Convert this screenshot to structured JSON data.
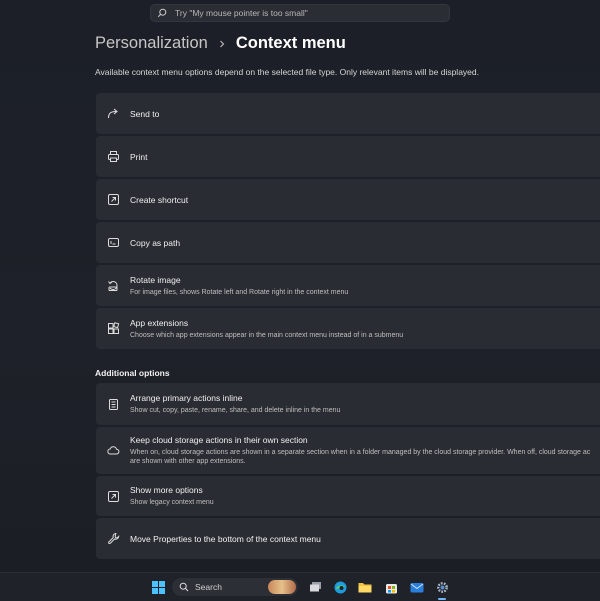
{
  "search": {
    "placeholder": "Try \"My mouse pointer is too small\""
  },
  "breadcrumb": {
    "parent": "Personalization",
    "separator": "›",
    "current": "Context menu"
  },
  "description": "Available context menu options depend on the selected file type. Only relevant items will be displayed.",
  "items": [
    {
      "title": "Send to",
      "subtitle": "",
      "icon": "share-arrow-icon"
    },
    {
      "title": "Print",
      "subtitle": "",
      "icon": "printer-icon"
    },
    {
      "title": "Create shortcut",
      "subtitle": "",
      "icon": "shortcut-icon"
    },
    {
      "title": "Copy as path",
      "subtitle": "",
      "icon": "copy-path-icon"
    },
    {
      "title": "Rotate image",
      "subtitle": "For image files, shows Rotate left and Rotate right in the context menu",
      "icon": "rotate-icon"
    },
    {
      "title": "App extensions",
      "subtitle": "Choose which app extensions appear in the main context menu instead of in a submenu",
      "icon": "app-extensions-icon"
    }
  ],
  "additional": {
    "header": "Additional options",
    "items": [
      {
        "title": "Arrange primary actions inline",
        "subtitle": "Show cut, copy, paste, rename, share, and delete inline in the menu",
        "icon": "list-icon"
      },
      {
        "title": "Keep cloud storage actions in their own section",
        "subtitle": "When on, cloud storage actions are shown in a separate section when in a folder managed by the cloud storage provider. When off, cloud storage ac",
        "subtitle2": "are shown with other app extensions.",
        "icon": "cloud-icon"
      },
      {
        "title": "Show more options",
        "subtitle": "Show legacy context menu",
        "icon": "external-window-icon"
      },
      {
        "title": "Move Properties to the bottom of the context menu",
        "subtitle": "",
        "icon": "wrench-icon"
      }
    ]
  },
  "taskbar": {
    "search_label": "Search",
    "icons": [
      "windows-start-icon",
      "task-view-icon",
      "edge-icon",
      "file-explorer-icon",
      "store-icon",
      "mail-icon",
      "settings-icon"
    ]
  }
}
